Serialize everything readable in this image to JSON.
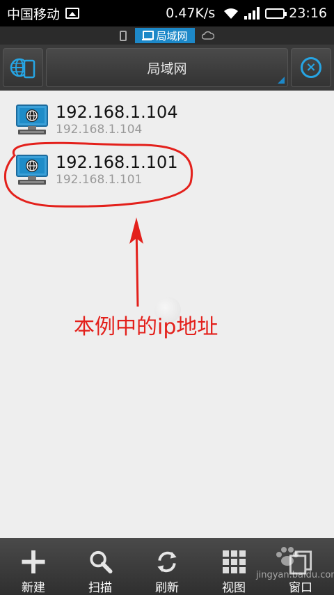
{
  "status_bar": {
    "carrier": "中国移动",
    "speed": "0.47K/s",
    "time": "23:16"
  },
  "mode_bar": {
    "active_tab": "局域网"
  },
  "toolbar": {
    "location_title": "局域网"
  },
  "devices": [
    {
      "name": "192.168.1.104",
      "address": "192.168.1.104"
    },
    {
      "name": "192.168.1.101",
      "address": "192.168.1.101"
    }
  ],
  "annotation": {
    "text": "本例中的ip地址",
    "color": "#e3201b"
  },
  "bottom_bar": {
    "items": [
      {
        "label": "新建",
        "icon": "plus-icon"
      },
      {
        "label": "扫描",
        "icon": "search-icon"
      },
      {
        "label": "刷新",
        "icon": "refresh-icon"
      },
      {
        "label": "视图",
        "icon": "grid-view-icon"
      },
      {
        "label": "窗口",
        "icon": "window-icon"
      }
    ]
  },
  "watermark": {
    "text": "jingyan.baidu.com"
  },
  "colors": {
    "accent": "#1d88c8",
    "status_bar_bg": "#000000",
    "toolbar_bg": "#3a3a3a",
    "list_bg": "#eeeeee"
  }
}
